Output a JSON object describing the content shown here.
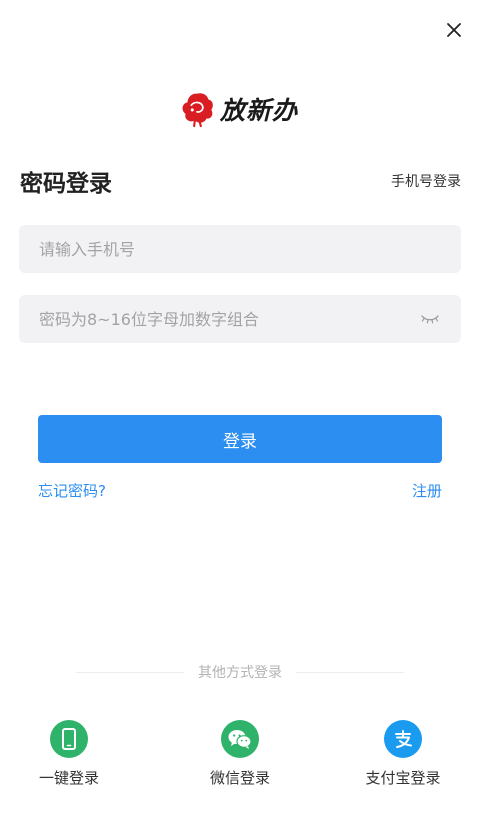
{
  "header": {
    "close_icon": "close-icon",
    "app_name": "放新办"
  },
  "login": {
    "title": "密码登录",
    "switch_mode_label": "手机号登录",
    "phone_placeholder": "请输入手机号",
    "password_placeholder": "密码为8~16位字母加数字组合",
    "password_toggle_icon": "eye-closed-icon",
    "submit_label": "登录",
    "forgot_label": "忘记密码?",
    "register_label": "注册"
  },
  "other_login": {
    "divider_label": "其他方式登录",
    "methods": [
      {
        "label": "一键登录",
        "icon": "phone-icon",
        "color": "#2fb36a"
      },
      {
        "label": "微信登录",
        "icon": "wechat-icon",
        "color": "#2fb36a"
      },
      {
        "label": "支付宝登录",
        "icon": "alipay-icon",
        "color": "#1a9bf0"
      }
    ]
  },
  "colors": {
    "accent": "#2b8ef0",
    "logo_red": "#d81e23",
    "field_bg": "#f2f2f4"
  }
}
